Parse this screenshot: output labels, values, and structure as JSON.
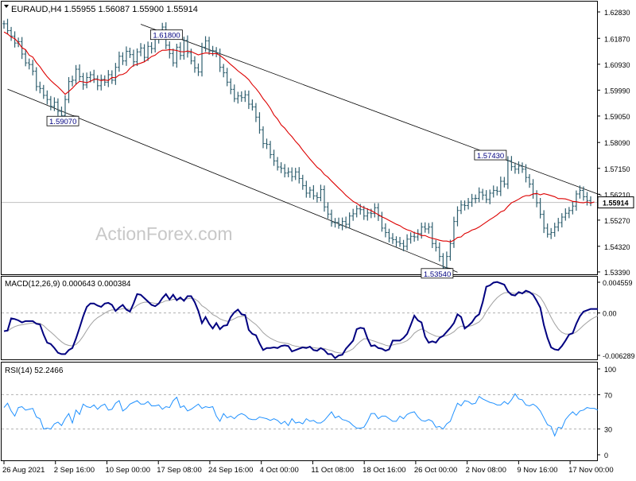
{
  "header": {
    "symbol_line": "EURAUD,H4  1.55955 1.56087 1.55900 1.55914",
    "macd_label": "MACD(12,26,9) 0.000643 0.000384",
    "rsi_label": "RSI(14) 52.2466",
    "watermark": "ActionForex.com"
  },
  "colors": {
    "price_bars": "#2f5f6f",
    "ma": "#dd0000",
    "channel": "#000000",
    "macd": "#000080",
    "macd_signal": "#a0a0a0",
    "rsi": "#1e90ff",
    "grid_dashed": "#b0b0b0",
    "bg": "#ffffff"
  },
  "chart_data": [
    {
      "type": "line",
      "panel": "price",
      "y_ticks": [
        "1.62830",
        "1.61870",
        "1.60930",
        "1.59990",
        "1.59050",
        "1.58090",
        "1.57150",
        "1.56210",
        "1.55270",
        "1.54320",
        "1.53390"
      ],
      "ylim": [
        1.5339,
        1.6283
      ],
      "current_price": "1.55914",
      "annotations": [
        {
          "label": "1.61800",
          "i": 50,
          "v": 1.618
        },
        {
          "label": "1.59070",
          "i": 19,
          "v": 1.5907
        },
        {
          "label": "1.53540",
          "i": 123,
          "v": 1.5354
        },
        {
          "label": "1.57430",
          "i": 140,
          "v": 1.5743
        }
      ],
      "x_tick_labels": [
        "26 Aug 2021",
        "2 Sep 16:00",
        "10 Sep 00:00",
        "17 Sep 08:00",
        "24 Sep 16:00",
        "4 Oct 00:00",
        "11 Oct 08:00",
        "18 Oct 16:00",
        "26 Oct 00:00",
        "2 Nov 08:00",
        "9 Nov 16:00",
        "17 Nov 00:00"
      ],
      "close_series": [
        1.624,
        1.6215,
        1.6195,
        1.617,
        1.6175,
        1.613,
        1.6098,
        1.6092,
        1.6068,
        1.6012,
        1.6005,
        1.598,
        1.5965,
        1.594,
        1.5955,
        1.5922,
        1.5907,
        1.5965,
        1.603,
        1.6035,
        1.6075,
        1.6048,
        1.6018,
        1.6045,
        1.6055,
        1.604,
        1.6015,
        1.6038,
        1.6028,
        1.6055,
        1.6035,
        1.6082,
        1.6122,
        1.6105,
        1.614,
        1.6128,
        1.6102,
        1.6138,
        1.6152,
        1.6118,
        1.6158,
        1.615,
        1.6185,
        1.6202,
        1.6228,
        1.6162,
        1.6132,
        1.6098,
        1.6155,
        1.6125,
        1.618,
        1.6135,
        1.6105,
        1.608,
        1.6065,
        1.6155,
        1.6178,
        1.6141,
        1.6142,
        1.6132,
        1.6082,
        1.6062,
        1.6028,
        1.6002,
        1.5968,
        1.5978,
        1.5972,
        1.5982,
        1.5948,
        1.5938,
        1.5901,
        1.5855,
        1.5805,
        1.5802,
        1.5765,
        1.5742,
        1.572,
        1.5715,
        1.5698,
        1.5702,
        1.5685,
        1.5702,
        1.5678,
        1.5652,
        1.5625,
        1.5636,
        1.5615,
        1.5609,
        1.5638,
        1.5575,
        1.5549,
        1.5518,
        1.5519,
        1.5508,
        1.5522,
        1.5512,
        1.5542,
        1.555,
        1.5568,
        1.5565,
        1.5542,
        1.5553,
        1.5551,
        1.5572,
        1.5542,
        1.5498,
        1.5482,
        1.5462,
        1.5456,
        1.5448,
        1.5442,
        1.5432,
        1.5458,
        1.5468,
        1.5466,
        1.5478,
        1.5502,
        1.5495,
        1.5502,
        1.5442,
        1.5428,
        1.5395,
        1.5354,
        1.5395,
        1.5442,
        1.5522,
        1.5562,
        1.5582,
        1.558,
        1.5592,
        1.5605,
        1.5606,
        1.5628,
        1.5618,
        1.5602,
        1.5625,
        1.5635,
        1.5632,
        1.5668,
        1.5658,
        1.5743,
        1.5721,
        1.5712,
        1.5723,
        1.5712,
        1.5682,
        1.5658,
        1.5622,
        1.559,
        1.5548,
        1.5498,
        1.5476,
        1.5482,
        1.5502,
        1.5518,
        1.5538,
        1.5552,
        1.5562,
        1.5578,
        1.5622,
        1.5635,
        1.5612,
        1.5598,
        1.5591
      ],
      "ma_series": [
        1.621,
        1.6203,
        1.6192,
        1.6186,
        1.6172,
        1.6153,
        1.6146,
        1.6126,
        1.6119,
        1.6099,
        1.6084,
        1.6065,
        1.6048,
        1.6034,
        1.6022,
        1.6011,
        1.5998,
        1.5984,
        1.5994,
        1.6006,
        1.602,
        1.6031,
        1.6029,
        1.6026,
        1.6031,
        1.6038,
        1.6038,
        1.6034,
        1.6036,
        1.6034,
        1.6045,
        1.6044,
        1.6054,
        1.6056,
        1.6063,
        1.6078,
        1.6089,
        1.6093,
        1.6097,
        1.6102,
        1.6111,
        1.6121,
        1.6126,
        1.6137,
        1.6144,
        1.6144,
        1.6146,
        1.6145,
        1.6143,
        1.6139,
        1.6138,
        1.6141,
        1.6139,
        1.6133,
        1.6127,
        1.6131,
        1.6134,
        1.6133,
        1.6131,
        1.6132,
        1.6125,
        1.6115,
        1.6104,
        1.6092,
        1.6081,
        1.6069,
        1.6059,
        1.6049,
        1.6037,
        1.6019,
        1.6005,
        1.5988,
        1.5968,
        1.5952,
        1.5933,
        1.5909,
        1.5894,
        1.5873,
        1.5861,
        1.5844,
        1.583,
        1.5813,
        1.5799,
        1.5781,
        1.5765,
        1.5749,
        1.5734,
        1.5719,
        1.5709,
        1.5693,
        1.5683,
        1.5669,
        1.5656,
        1.5643,
        1.5631,
        1.5617,
        1.5606,
        1.5595,
        1.5588,
        1.5578,
        1.5572,
        1.5567,
        1.5562,
        1.5554,
        1.5547,
        1.5539,
        1.5533,
        1.5526,
        1.5519,
        1.5512,
        1.5507,
        1.5498,
        1.5492,
        1.5488,
        1.5481,
        1.5478,
        1.5471,
        1.5471,
        1.5465,
        1.5461,
        1.5458,
        1.5454,
        1.5451,
        1.5451,
        1.5448,
        1.5454,
        1.5464,
        1.5466,
        1.5478,
        1.5483,
        1.5491,
        1.5495,
        1.5502,
        1.5511,
        1.552,
        1.5529,
        1.5537,
        1.5546,
        1.5557,
        1.5562,
        1.5577,
        1.559,
        1.5596,
        1.5603,
        1.5611,
        1.5616,
        1.5616,
        1.5622,
        1.5624,
        1.5619,
        1.5623,
        1.562,
        1.5616,
        1.5612,
        1.5605,
        1.5605,
        1.5604,
        1.56,
        1.5595,
        1.5594,
        1.5591,
        1.559,
        1.5593,
        1.5589,
        1.5593
      ]
    },
    {
      "type": "line",
      "panel": "macd",
      "title": "MACD(12,26,9) 0.000643 0.000384",
      "y_ticks": [
        "0.004559",
        "0.00",
        "-0.006289"
      ],
      "ylim": [
        -0.006289,
        0.004559
      ],
      "macd_series": [
        -0.0027,
        -0.0026,
        -0.0008,
        -0.0009,
        -0.0011,
        -0.0014,
        -0.0012,
        -0.0012,
        -0.0012,
        -0.0016,
        -0.0017,
        -0.0032,
        -0.0044,
        -0.0046,
        -0.0052,
        -0.0059,
        -0.0061,
        -0.0061,
        -0.0055,
        -0.0052,
        -0.0038,
        -0.0022,
        -0.0005,
        0.0009,
        0.0014,
        0.0014,
        0.0011,
        0.0009,
        0.0014,
        0.0015,
        0.0012,
        0.0003,
        0.0008,
        0.0012,
        0.0005,
        0.0002,
        0.0014,
        0.0028,
        0.0027,
        0.0022,
        0.0017,
        0.0012,
        0.001,
        0.0014,
        0.0022,
        0.0028,
        0.002,
        0.0027,
        0.0019,
        0.0023,
        0.0018,
        0.0025,
        0.0025,
        0.0016,
        0.0003,
        -0.0015,
        -0.0006,
        -0.0016,
        -0.0023,
        -0.0015,
        -0.0024,
        -0.0019,
        -0.0018,
        -0.0006,
        0.0001,
        0.0005,
        -0.0002,
        -0.0003,
        -0.0025,
        -0.0031,
        -0.0033,
        -0.0045,
        -0.0055,
        -0.0052,
        -0.0052,
        -0.0051,
        -0.0052,
        -0.0049,
        -0.0048,
        -0.0049,
        -0.0057,
        -0.0055,
        -0.0053,
        -0.0051,
        -0.0052,
        -0.005,
        -0.0055,
        -0.0056,
        -0.0052,
        -0.0055,
        -0.0061,
        -0.0061,
        -0.0067,
        -0.0063,
        -0.0062,
        -0.0053,
        -0.0047,
        -0.0041,
        -0.0024,
        -0.0022,
        -0.0023,
        -0.0038,
        -0.0049,
        -0.0048,
        -0.0052,
        -0.0053,
        -0.0056,
        -0.0054,
        -0.0041,
        -0.0041,
        -0.0041,
        -0.0037,
        -0.0031,
        -0.0018,
        -0.0004,
        -0.0011,
        -0.0014,
        -0.0035,
        -0.0044,
        -0.0042,
        -0.0044,
        -0.0037,
        -0.0034,
        -0.0028,
        -0.0022,
        -0.0015,
        -0.0002,
        -0.0006,
        -0.0023,
        -0.0019,
        -0.0014,
        -0.0006,
        -0.0002,
        0.0016,
        0.0039,
        0.0041,
        0.0045,
        0.0046,
        0.0044,
        0.0042,
        0.0032,
        0.0027,
        0.0026,
        0.0031,
        0.0029,
        0.0033,
        0.0031,
        0.0027,
        0.0018,
        0.0008,
        -0.0018,
        -0.0037,
        -0.0051,
        -0.0054,
        -0.0055,
        -0.0049,
        -0.0041,
        -0.0032,
        -0.003,
        -0.0016,
        -0.0005,
        0.0002,
        0.0004,
        0.0006,
        0.0006,
        0.0006
      ]
    },
    {
      "type": "line",
      "panel": "rsi",
      "title": "RSI(14) 52.2466",
      "y_ticks": [
        "100",
        "70",
        "30",
        "0"
      ],
      "ylim": [
        0,
        100
      ],
      "levels": [
        70,
        30
      ],
      "rsi_series": [
        55,
        60,
        51,
        45,
        55,
        56,
        52,
        53,
        54,
        44,
        42,
        30,
        31,
        30,
        36,
        38,
        34,
        42,
        48,
        37,
        52,
        47,
        59,
        56,
        55,
        58,
        53,
        57,
        59,
        52,
        53,
        60,
        63,
        51,
        54,
        59,
        61,
        63,
        59,
        59,
        62,
        57,
        57,
        58,
        53,
        56,
        55,
        63,
        67,
        55,
        57,
        51,
        53,
        56,
        59,
        54,
        56,
        55,
        56,
        45,
        39,
        48,
        43,
        45,
        42,
        46,
        48,
        46,
        42,
        41,
        41,
        44,
        43,
        42,
        40,
        42,
        40,
        36,
        39,
        34,
        42,
        37,
        38,
        36,
        42,
        39,
        40,
        37,
        37,
        40,
        45,
        50,
        43,
        45,
        41,
        40,
        38,
        34,
        31,
        31,
        32,
        39,
        48,
        48,
        42,
        45,
        45,
        42,
        39,
        39,
        45,
        42,
        47,
        49,
        50,
        44,
        40,
        39,
        41,
        39,
        32,
        33,
        30,
        36,
        39,
        50,
        60,
        57,
        63,
        62,
        59,
        60,
        68,
        65,
        63,
        61,
        60,
        58,
        58,
        62,
        59,
        64,
        71,
        65,
        64,
        58,
        57,
        59,
        56,
        51,
        43,
        35,
        33,
        22,
        32,
        31,
        41,
        46,
        50,
        46,
        51,
        52,
        55,
        54,
        54,
        52
      ]
    }
  ]
}
